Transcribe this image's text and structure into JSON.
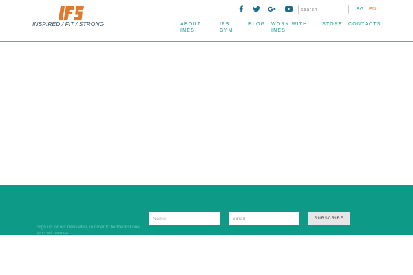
{
  "brand": {
    "logo_text": "IFS",
    "tagline": "INSPIRED / FIT / STRONG",
    "logo_color": "#e07a2e"
  },
  "header": {
    "social": [
      {
        "icon": "facebook-icon"
      },
      {
        "icon": "twitter-icon"
      },
      {
        "icon": "google-plus-icon"
      },
      {
        "icon": "youtube-icon"
      }
    ],
    "search": {
      "placeholder": "search",
      "value": ""
    },
    "languages": [
      {
        "code": "BG",
        "color": "#1a9a8c"
      },
      {
        "code": "EN",
        "color": "#e07a2e",
        "active": true
      }
    ]
  },
  "nav": {
    "items": [
      {
        "label": "ABOUT INES"
      },
      {
        "label": "IFS GYM"
      },
      {
        "label": "BLOG"
      },
      {
        "label": "WORK WITH INES"
      },
      {
        "label": "STORE"
      },
      {
        "label": "CONTACTS"
      }
    ]
  },
  "footer": {
    "newsletter_text": "Sign up for our newsletter, in order to be the first one who will receive ...",
    "name_placeholder": "Name",
    "email_placeholder": "Email",
    "subscribe_label": "SUBSCRIBE",
    "background": "#0d9a86"
  },
  "colors": {
    "accent": "#e07a2e",
    "teal": "#1a9a8c",
    "footer_teal": "#0d9a86"
  }
}
